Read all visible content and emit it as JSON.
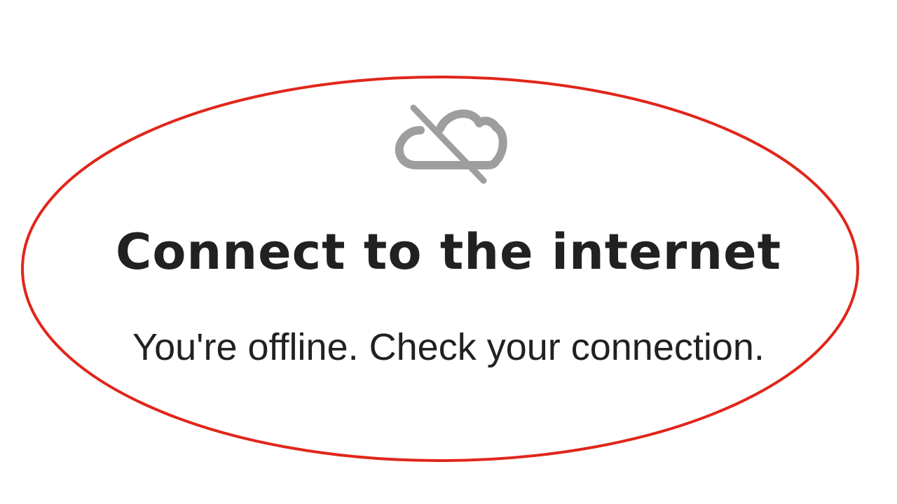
{
  "screen": {
    "icon": "cloud-off-icon",
    "title": "Connect to the internet",
    "message": "You're offline. Check your connection."
  },
  "colors": {
    "background": "#ffffff",
    "text": "#212121",
    "icon": "#9e9e9e",
    "highlight": "#e0261b"
  }
}
